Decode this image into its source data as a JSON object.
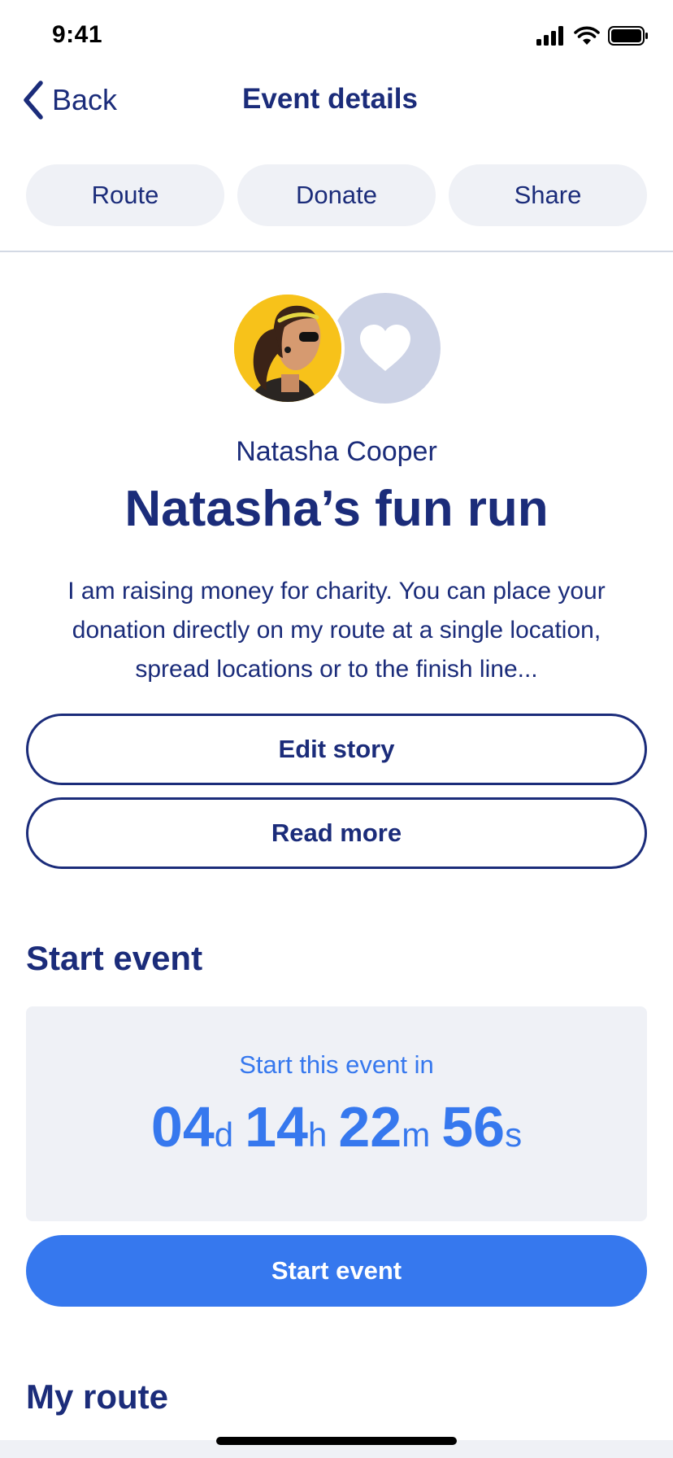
{
  "status_bar": {
    "time": "9:41"
  },
  "nav": {
    "back_label": "Back",
    "title": "Event details"
  },
  "tabs": [
    {
      "label": "Route"
    },
    {
      "label": "Donate"
    },
    {
      "label": "Share"
    }
  ],
  "event": {
    "owner_name": "Natasha Cooper",
    "title": "Natasha’s fun run",
    "story": "I am raising money for charity. You can place your donation directly on my route at a single location, spread locations or to the finish line..."
  },
  "buttons": {
    "edit_story": "Edit story",
    "read_more": "Read more",
    "start_event": "Start event"
  },
  "start_section": {
    "heading": "Start event",
    "countdown_label": "Start this event in",
    "days": "04",
    "days_unit": "d",
    "hours": "14",
    "hours_unit": "h",
    "minutes": "22",
    "minutes_unit": "m",
    "seconds": "56",
    "seconds_unit": "s"
  },
  "route_section": {
    "heading": "My route"
  },
  "colors": {
    "primary_navy": "#1b2c7a",
    "accent_blue": "#3678ee",
    "surface_grey": "#eff1f6",
    "avatar_yellow": "#f7c21a",
    "charity_grey": "#cdd3e6"
  },
  "icons": {
    "back": "chevron-left-icon",
    "charity": "heart-icon",
    "signal": "cellular-signal-icon",
    "wifi": "wifi-icon",
    "battery": "battery-icon"
  }
}
